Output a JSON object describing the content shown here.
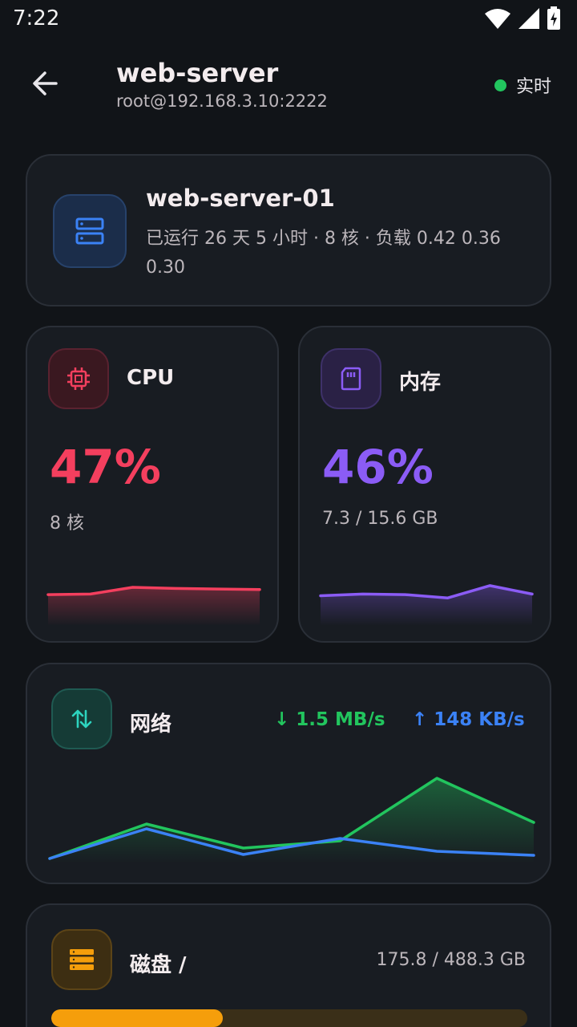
{
  "status_bar": {
    "time": "7:22",
    "icons": [
      "wifi-icon",
      "signal-icon",
      "battery-charging-icon"
    ]
  },
  "header": {
    "title": "web-server",
    "subtitle": "root@192.168.3.10:2222",
    "live_label": "实时",
    "live_color": "#22c55e"
  },
  "server": {
    "name": "web-server-01",
    "info": "已运行 26 天 5 小时 · 8 核 · 负载 0.42 0.36 0.30",
    "icon": "server-icon"
  },
  "cpu": {
    "label": "CPU",
    "value": "47%",
    "sub": "8 核",
    "color": "#f43f5e",
    "icon": "cpu-icon",
    "history": [
      0.47,
      0.48,
      0.6,
      0.58,
      0.57,
      0.56
    ]
  },
  "memory": {
    "label": "内存",
    "value": "46%",
    "sub": "7.3 / 15.6 GB",
    "color": "#8b5cf6",
    "icon": "memory-card-icon",
    "history": [
      0.45,
      0.48,
      0.47,
      0.41,
      0.63,
      0.48
    ]
  },
  "network": {
    "label": "网络",
    "down": "↓ 1.5 MB/s",
    "up": "↑ 148 KB/s",
    "down_color": "#22c55e",
    "up_color": "#3b82f6",
    "icon": "transfer-arrows-icon",
    "down_history": [
      0.0,
      0.43,
      0.13,
      0.22,
      1.0,
      0.45
    ],
    "up_history": [
      0.0,
      0.37,
      0.05,
      0.25,
      0.09,
      0.04
    ]
  },
  "disk": {
    "label": "磁盘 /",
    "usage": "175.8 / 488.3 GB",
    "used_fraction": 0.36,
    "color": "#f59e0b",
    "icon": "disk-stack-icon"
  }
}
